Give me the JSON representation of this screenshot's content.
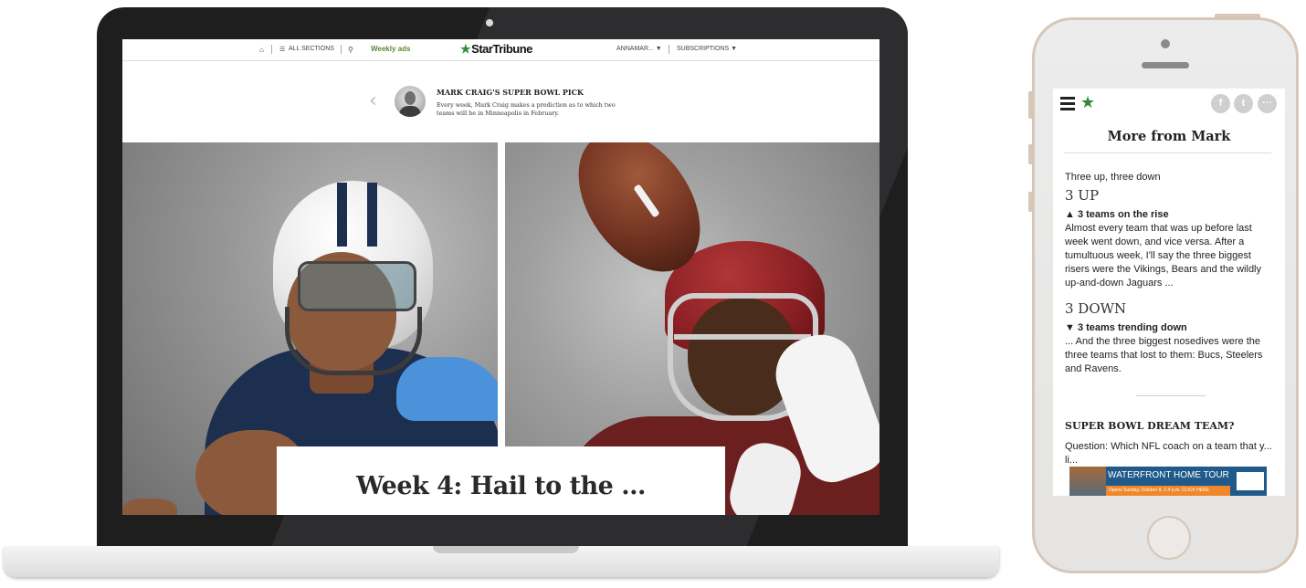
{
  "laptop": {
    "nav": {
      "home_icon": "house-icon",
      "sections_label": "ALL SECTIONS",
      "search_icon": "search-icon",
      "weekly_ads_label": "Weekly ads",
      "logo_text": "StarTribune",
      "user_label": "ANNAMAR...",
      "subscriptions_label": "SUBSCRIPTIONS"
    },
    "feature": {
      "title": "MARK CRAIG'S SUPER BOWL PICK",
      "description": "Every week, Mark Craig makes a prediction as to which two teams will be in Minneapolis in February."
    },
    "headline": "Week 4: Hail to the ..."
  },
  "phone": {
    "share_icons": [
      "facebook-icon",
      "twitter-icon",
      "more-icon"
    ],
    "more_title": "More from Mark",
    "intro": "Three up, three down",
    "up_heading": "3 UP",
    "up_sub": "▲ 3 teams on the rise",
    "up_text": "Almost every team that was up before last week went down, and vice versa. After a tumultuous week, I'll say the three biggest risers were the Vikings, Bears and the wildly up-and-down Jaguars ...",
    "down_heading": "3 DOWN",
    "down_sub": "▼ 3 teams trending down",
    "down_text": "... And the three biggest nosedives were the three teams that lost to them: Bucs, Steelers and Ravens.",
    "dream_title": "SUPER BOWL DREAM TEAM?",
    "dream_text": "Question: Which NFL coach on a team that y... li...",
    "ad": {
      "title": "WATERFRONT HOME TOUR",
      "subtitle": "Opens Sunday, October 8, 1-4 p.m.   CLICK HERE"
    }
  }
}
